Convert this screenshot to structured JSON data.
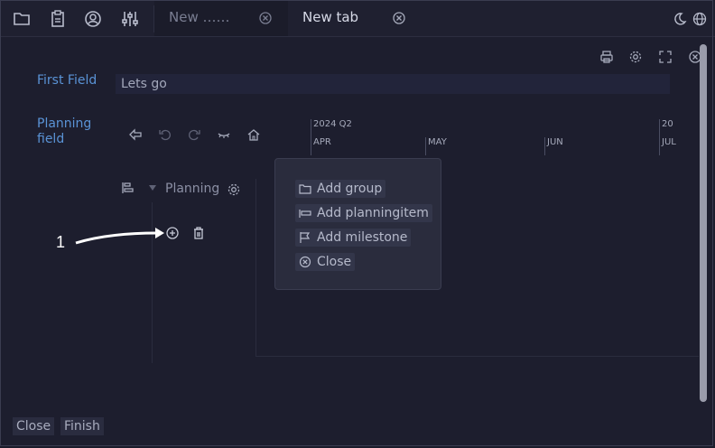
{
  "tabs": [
    {
      "label": "New ……",
      "active": false
    },
    {
      "label": "New tab",
      "active": true
    }
  ],
  "form": {
    "first_field_label": "First Field",
    "first_field_value": "Lets go",
    "planning_field_label_line1": "Planning",
    "planning_field_label_line2": "field"
  },
  "timeline": {
    "year_quarter": "2024  Q2",
    "year_partial": "20",
    "months": [
      "APR",
      "MAY",
      "JUN",
      "JUL"
    ]
  },
  "planning": {
    "group_label": "Planning"
  },
  "popup_menu": {
    "items": [
      "Add group",
      "Add planningitem",
      "Add milestone",
      "Close"
    ]
  },
  "annotation": {
    "number": "1"
  },
  "bottom": {
    "close_label": "Close",
    "finish_label": "Finish"
  },
  "colors": {
    "field_label": "#5a93d6",
    "background": "#1d1e2e",
    "popup": "#2a2c3d"
  }
}
